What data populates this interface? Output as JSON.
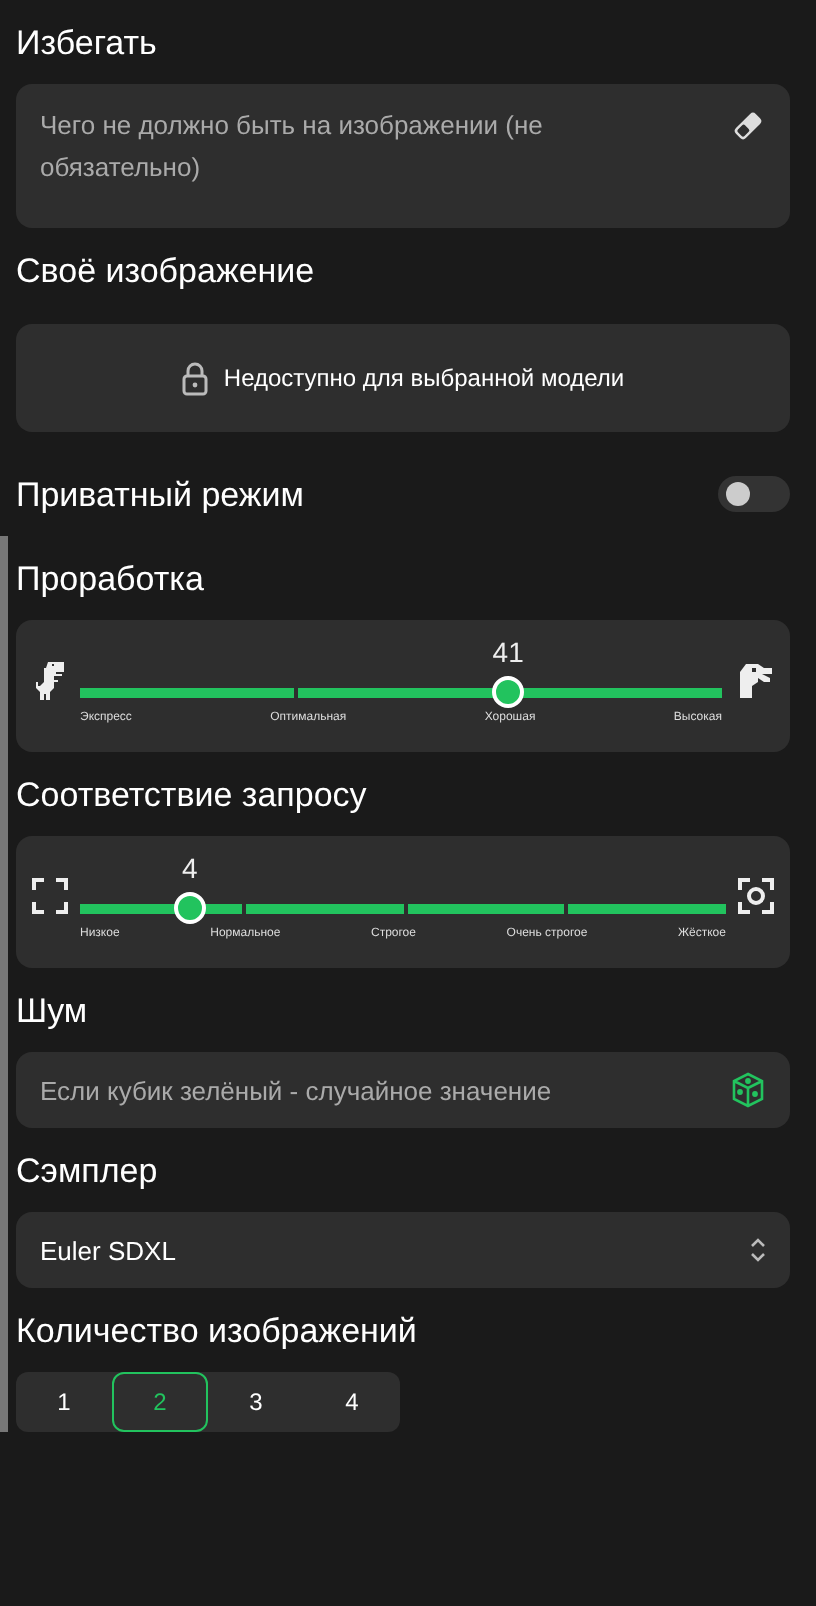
{
  "avoid": {
    "title": "Избегать",
    "placeholder": "Чего не должно быть на изображении (не обязательно)"
  },
  "custom_image": {
    "title": "Своё изображение",
    "message": "Недоступно для выбранной модели"
  },
  "private_mode": {
    "title": "Приватный режим",
    "on": false
  },
  "sliders": [
    {
      "title": "Проработка",
      "value": "41",
      "level": 0.667,
      "kind": "quality",
      "labels": [
        "Экспресс",
        "Оптимальная",
        "Хорошая",
        "Высокая"
      ]
    },
    {
      "title": "Соответствие запросу",
      "value": "4",
      "level": 0.17,
      "kind": "adherence",
      "labels": [
        "Низкое",
        "Нормальное",
        "Строгое",
        "Очень строгое",
        "Жёсткое"
      ]
    }
  ],
  "noise": {
    "title": "Шум",
    "placeholder": "Если кубик зелёный - случайное значение"
  },
  "sampler": {
    "title": "Сэмплер",
    "value": "Euler SDXL"
  },
  "image_count": {
    "title": "Количество изображений",
    "options": [
      {
        "label": "1",
        "selected": false
      },
      {
        "label": "2",
        "selected": true
      },
      {
        "label": "3",
        "selected": false
      },
      {
        "label": "4",
        "selected": false
      }
    ]
  }
}
